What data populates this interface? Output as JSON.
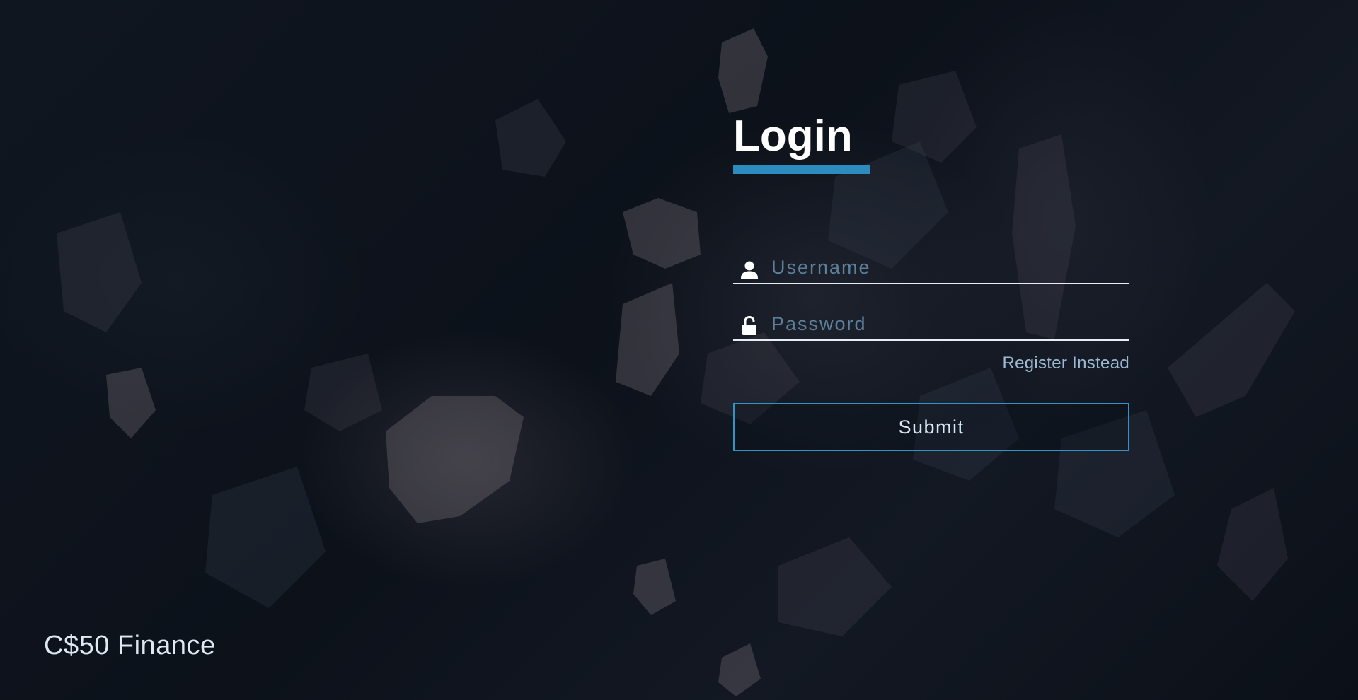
{
  "brand": {
    "name": "C$50 Finance"
  },
  "login": {
    "title": "Login",
    "accent_color": "#2c8bbf",
    "username": {
      "placeholder": "Username",
      "value": "",
      "icon": "user-icon"
    },
    "password": {
      "placeholder": "Password",
      "value": "",
      "icon": "lock-icon"
    },
    "register_link": "Register Instead",
    "submit_label": "Submit"
  }
}
